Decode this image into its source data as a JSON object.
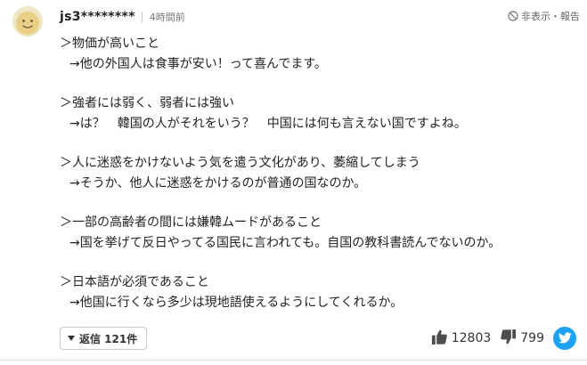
{
  "comment": {
    "username": "js3********",
    "time": "4時間前",
    "hide_report_label": "非表示・報告",
    "paragraphs": [
      {
        "lines": [
          "＞物価が高いこと",
          "→他の外国人は食事が安い！って喜んでます。"
        ]
      },
      {
        "lines": [
          "＞強者には弱く、弱者には強い",
          "→は？　韓国の人がそれをいう？　中国には何も言えない国ですよね。"
        ]
      },
      {
        "lines": [
          "＞人に迷惑をかけないよう気を遣う文化があり、萎縮してしまう",
          "→そうか、他人に迷惑をかけるのが普通の国なのか。"
        ]
      },
      {
        "lines": [
          "＞一部の高齢者の間には嫌韓ムードがあること",
          "→国を挙げて反日やってる国民に言われても。自国の教科書読んでないのか。"
        ]
      },
      {
        "lines": [
          "＞日本語が必須であること",
          "→他国に行くなら多少は現地語使えるようにしてくれるか。"
        ]
      }
    ],
    "reply_label": "返信 121件",
    "likes": "12803",
    "dislikes": "799",
    "icons": {
      "avatar": "smiley-face-avatar",
      "hide": "prohibited-circle-icon",
      "reply": "triangle-down-icon",
      "like": "thumbs-up-icon",
      "dislike": "thumbs-down-icon",
      "share": "twitter-bird-icon"
    },
    "colors": {
      "twitter": "#1da1f2",
      "avatar_bg": "#efe6c5",
      "avatar_face": "#e9cf86"
    }
  }
}
